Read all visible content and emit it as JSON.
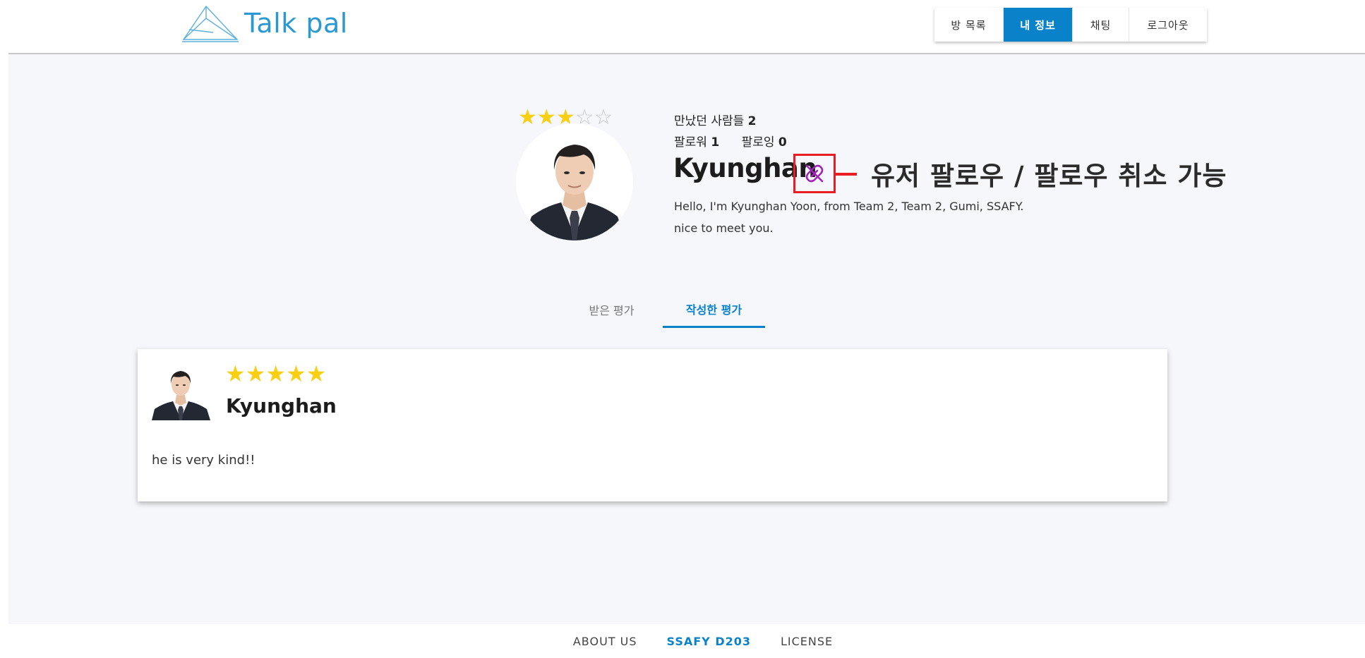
{
  "header": {
    "logo_text": "Talk pal",
    "nav": [
      {
        "label": "방 목록",
        "active": false
      },
      {
        "label": "내 정보",
        "active": true
      },
      {
        "label": "채팅",
        "active": false
      },
      {
        "label": "로그아웃",
        "active": false
      }
    ]
  },
  "profile": {
    "rating": 3,
    "rating_max": 5,
    "met_label": "만났던 사람들",
    "met_count": "2",
    "followers_label": "팔로워",
    "followers_count": "1",
    "following_label": "팔로잉",
    "following_count": "0",
    "username": "Kyunghan",
    "follow_icon": "link-off-icon",
    "bio": "Hello, I'm Kyunghan Yoon, from Team 2, Team 2, Gumi, SSAFY. nice to meet you.",
    "annotation": "유저 팔로우 / 팔로우 취소 가능"
  },
  "tabs": [
    {
      "label": "받은 평가",
      "active": false
    },
    {
      "label": "작성한 평가",
      "active": true
    }
  ],
  "reviews": [
    {
      "rating": 5,
      "rating_max": 5,
      "name": "Kyunghan",
      "text": "he is very kind!!"
    }
  ],
  "footer": {
    "links": [
      "ABOUT US",
      "SSAFY D203",
      "LICENSE"
    ]
  },
  "colors": {
    "accent": "#0a82c9",
    "logo": "#2a98d2",
    "star": "#f8cf12",
    "star_empty": "#c9c9c9",
    "annotation_red": "#ea1c24",
    "follow_icon": "#a025b5"
  }
}
